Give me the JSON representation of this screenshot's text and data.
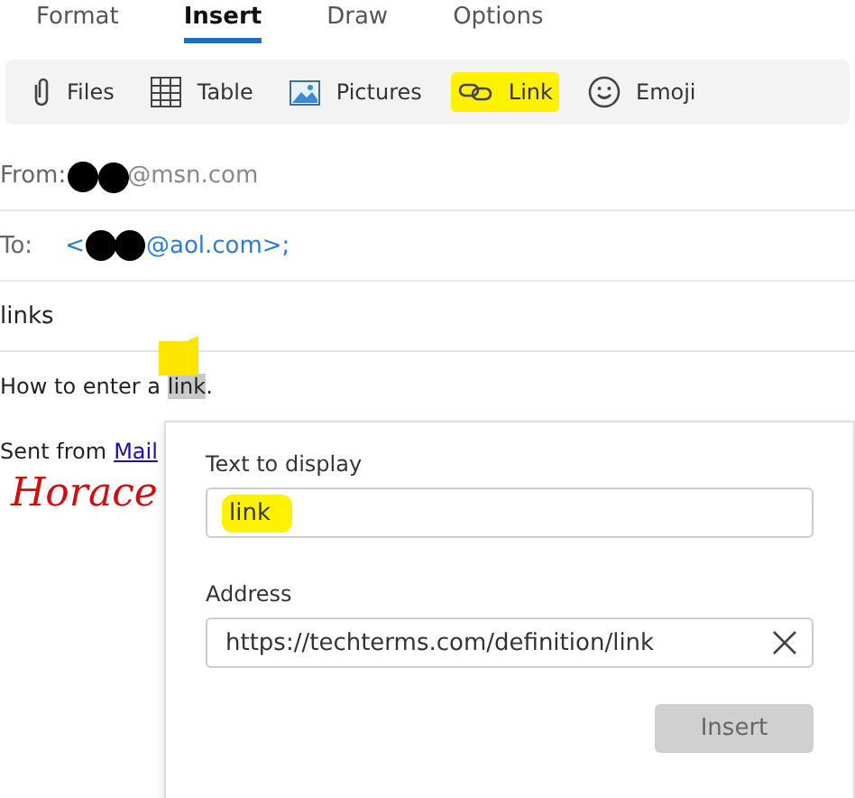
{
  "tabs": [
    {
      "label": "Format",
      "selected": false
    },
    {
      "label": "Insert",
      "selected": true
    },
    {
      "label": "Draw",
      "selected": false
    },
    {
      "label": "Options",
      "selected": false
    }
  ],
  "toolbar": [
    {
      "kind": "files",
      "label": "Files",
      "highlighted": false
    },
    {
      "kind": "table",
      "label": "Table",
      "highlighted": false
    },
    {
      "kind": "pictures",
      "label": "Pictures",
      "highlighted": false
    },
    {
      "kind": "link",
      "label": "Link",
      "highlighted": true
    },
    {
      "kind": "emoji",
      "label": "Emoji",
      "highlighted": false
    }
  ],
  "from": {
    "label": "From:",
    "address": "@msn.com"
  },
  "to": {
    "label": "To:",
    "prefix": "<",
    "address": "@aol.com>;"
  },
  "subject": "links",
  "body": {
    "before": "How to enter a ",
    "selection": "link",
    "after": "."
  },
  "signature": {
    "text": "Sent from",
    "link": "Mail",
    "name": "Horace"
  },
  "link_dialog": {
    "display_label": "Text to display",
    "display_value": "link",
    "display_highlighted": true,
    "address_label": "Address",
    "address_value": "https://techterms.com/definition/link",
    "insert_button": {
      "label": "Insert",
      "disabled": true
    }
  }
}
